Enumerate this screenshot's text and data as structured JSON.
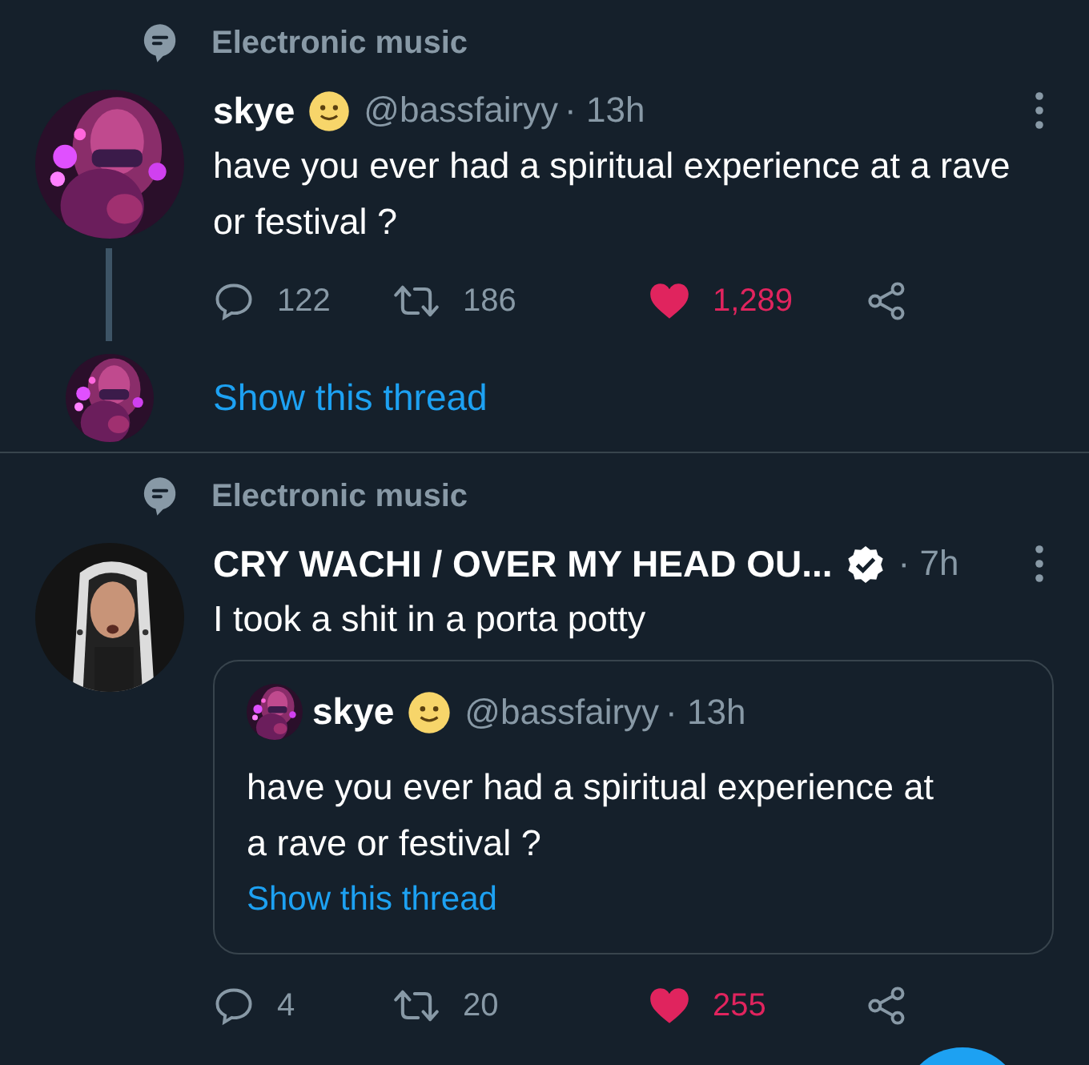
{
  "tweets": [
    {
      "kind": "thread",
      "topic": "Electronic music",
      "name": "skye",
      "verified": false,
      "emoji": true,
      "handle": "@bassfairyy",
      "time": "· 13h",
      "text": "have you ever had a spiritual experience at a rave or festival ?",
      "stats": {
        "replies": "122",
        "retweets": "186",
        "likes": "1,289",
        "liked": true
      },
      "thread_link": "Show this thread"
    },
    {
      "kind": "quote",
      "topic": "Electronic music",
      "name": "CRY WACHI / OVER MY HEAD OU...",
      "verified": true,
      "emoji": false,
      "time": "· 7h",
      "text": "I took a shit in a porta potty",
      "stats": {
        "replies": "4",
        "retweets": "20",
        "likes": "255",
        "liked": true
      },
      "quote": {
        "name": "skye",
        "emoji": true,
        "handle": "@bassfairyy",
        "time": "· 13h",
        "text": "have you ever had a spiritual experience at a rave or festival ?",
        "thread_link": "Show this thread"
      }
    }
  ]
}
